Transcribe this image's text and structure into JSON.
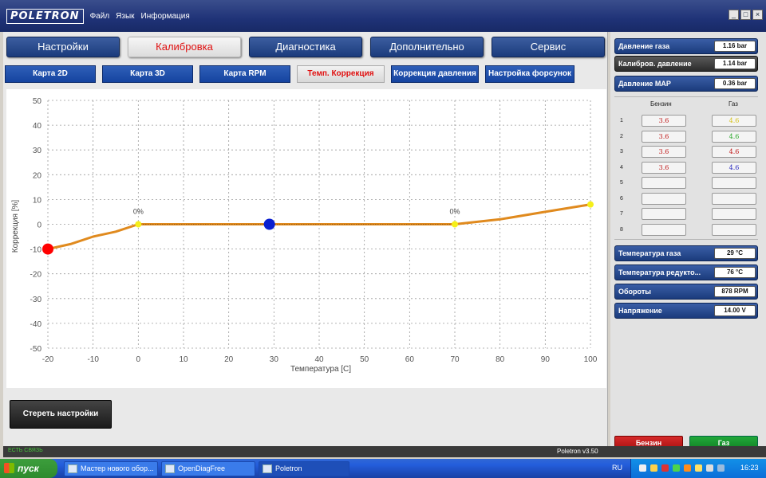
{
  "window": {
    "logo": "POLETRON",
    "menu": [
      "Файл",
      "Язык",
      "Информация"
    ]
  },
  "tabs": [
    {
      "label": "Настройки",
      "active": false
    },
    {
      "label": "Калибровка",
      "active": true
    },
    {
      "label": "Диагностика",
      "active": false
    },
    {
      "label": "Дополнительно",
      "active": false
    },
    {
      "label": "Сервис",
      "active": false
    }
  ],
  "subtabs": [
    {
      "label": "Карта 2D",
      "active": false
    },
    {
      "label": "Карта 3D",
      "active": false
    },
    {
      "label": "Карта RPM",
      "active": false
    },
    {
      "label": "Темп. Коррекция",
      "active": true
    },
    {
      "label": "Коррекция давления",
      "active": false
    },
    {
      "label": "Настройка форсунок",
      "active": false
    }
  ],
  "chart_data": {
    "type": "line",
    "xlabel": "Температура [C]",
    "ylabel": "Коррекция [%]",
    "xlim": [
      -20,
      100
    ],
    "ylim": [
      -50,
      50
    ],
    "x_ticks": [
      -20,
      -10,
      0,
      10,
      20,
      30,
      40,
      50,
      60,
      70,
      80,
      90,
      100
    ],
    "y_ticks": [
      50,
      40,
      30,
      20,
      10,
      0,
      -10,
      -20,
      -30,
      -40,
      -50
    ],
    "grid": true,
    "series": [
      {
        "values": [
          [
            -20,
            -10
          ],
          [
            -15,
            -8
          ],
          [
            -10,
            -5
          ],
          [
            -5,
            -3
          ],
          [
            0,
            0
          ],
          [
            29,
            0
          ],
          [
            70,
            0
          ],
          [
            80,
            2
          ],
          [
            90,
            5
          ],
          [
            100,
            8
          ]
        ],
        "color": "#e08a1e"
      }
    ],
    "control_points": [
      {
        "x": -20,
        "y": -10,
        "color": "#ff0000",
        "size": "large"
      },
      {
        "x": 0,
        "y": 0,
        "color": "#f5ef1a",
        "size": "small"
      },
      {
        "x": 29,
        "y": 0,
        "color": "#0a1fd0",
        "size": "large"
      },
      {
        "x": 70,
        "y": 0,
        "color": "#f5ef1a",
        "size": "small"
      },
      {
        "x": 100,
        "y": 8,
        "color": "#f5ef1a",
        "size": "small"
      }
    ],
    "annotations": [
      {
        "x": 0,
        "y": 0,
        "text": "0%"
      },
      {
        "x": 70,
        "y": 0,
        "text": "0%"
      }
    ]
  },
  "buttons": {
    "erase": "Стереть настройки",
    "petrol": "Бензин",
    "gas": "Газ"
  },
  "side": {
    "top_params": [
      {
        "label": "Давление газа",
        "value": "1.16 bar",
        "style": "blue"
      },
      {
        "label": "Калибров. давление",
        "value": "1.14 bar",
        "style": "dark"
      },
      {
        "label": "Давление MAP",
        "value": "0.36 bar",
        "style": "blue"
      }
    ],
    "col_petrol": "Бензин",
    "col_gas": "Газ",
    "cylinders": [
      {
        "n": "1",
        "petrol": "3.6",
        "gas": "4.6",
        "gas_color": "#d6c21a"
      },
      {
        "n": "2",
        "petrol": "3.6",
        "gas": "4.6",
        "gas_color": "#2aa82a"
      },
      {
        "n": "3",
        "petrol": "3.6",
        "gas": "4.6",
        "gas_color": "#c01818"
      },
      {
        "n": "4",
        "petrol": "3.6",
        "gas": "4.6",
        "gas_color": "#2a2ac0"
      },
      {
        "n": "5",
        "petrol": "",
        "gas": "",
        "gas_color": "#000"
      },
      {
        "n": "6",
        "petrol": "",
        "gas": "",
        "gas_color": "#000"
      },
      {
        "n": "7",
        "petrol": "",
        "gas": "",
        "gas_color": "#000"
      },
      {
        "n": "8",
        "petrol": "",
        "gas": "",
        "gas_color": "#000"
      }
    ],
    "bottom_params": [
      {
        "label": "Температура газа",
        "value": "29 °C"
      },
      {
        "label": "Температура редукто...",
        "value": "76 °C"
      },
      {
        "label": "Обороты",
        "value": "878 RPM"
      },
      {
        "label": "Напряжение",
        "value": "14.00 V"
      }
    ]
  },
  "status": {
    "connection": "ЕСТЬ СВЯЗЬ",
    "version": "Poletron v3.50"
  },
  "taskbar": {
    "start": "пуск",
    "tasks": [
      "Мастер нового обор...",
      "OpenDiagFree",
      "Poletron"
    ],
    "lang": "RU",
    "clock": "16:23"
  },
  "colors": {
    "accent_blue": "#1b3b7c",
    "active_red": "#e01010",
    "curve": "#e08a1e"
  }
}
